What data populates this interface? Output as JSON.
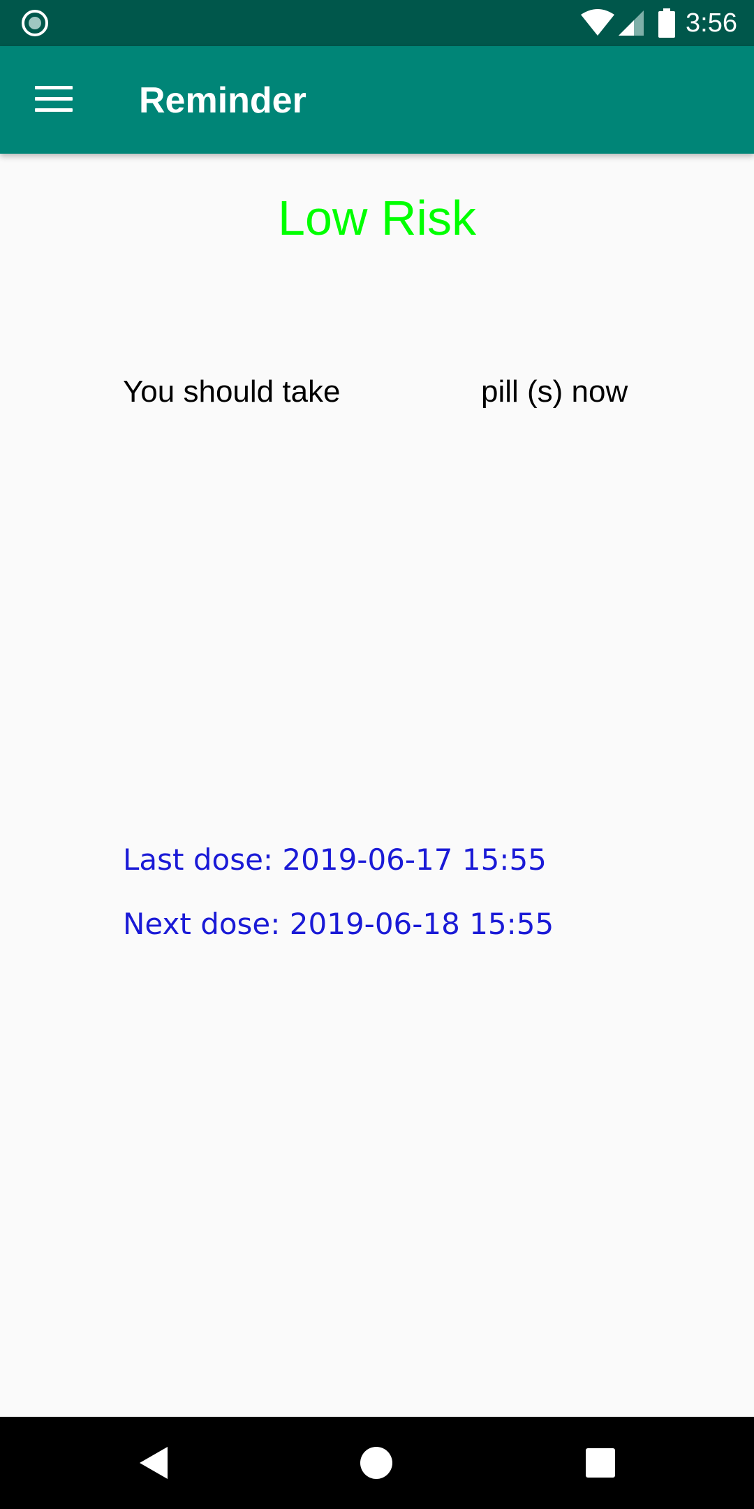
{
  "status_bar": {
    "time": "3:56",
    "left_icon": "record-indicator-icon",
    "wifi_icon": "wifi-icon",
    "signal_icon": "cell-signal-icon",
    "battery_icon": "battery-icon"
  },
  "app_bar": {
    "title": "Reminder",
    "menu_icon": "hamburger-menu-icon"
  },
  "main": {
    "risk_label": "Low Risk",
    "take_prefix": "You should take",
    "pill_count": "",
    "take_suffix": "pill (s) now",
    "last_dose": "Last dose: 2019-06-17 15:55",
    "next_dose": "Next dose: 2019-06-18 15:55"
  },
  "nav_bar": {
    "back_icon": "back-icon",
    "home_icon": "home-icon",
    "recents_icon": "recents-icon"
  },
  "colors": {
    "status_bar": "#00574b",
    "app_bar": "#008577",
    "risk_text": "#00ff00",
    "dose_text": "#1a1ad6",
    "background": "#fafafa"
  }
}
